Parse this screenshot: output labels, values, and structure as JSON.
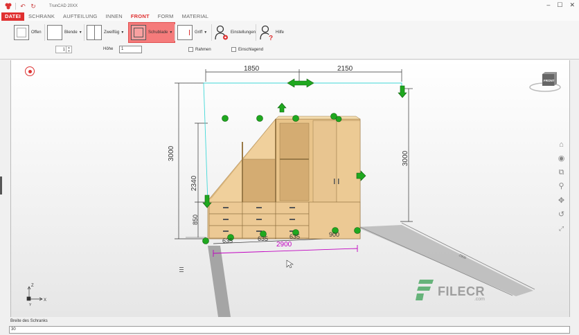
{
  "app": {
    "title": "TrunCAD 20XX"
  },
  "menu": {
    "items": [
      "DATEI",
      "SCHRANK",
      "AUFTEILUNG",
      "INNEN",
      "FRONT",
      "FORM",
      "MATERIAL"
    ],
    "active": "FRONT"
  },
  "ribbon": {
    "offen": "Offen",
    "blende": "Blende",
    "zweifluegelig": "Zweiflüg",
    "schublade": "Schublade",
    "griff": "Griff",
    "einstellungen": "Einstellungen",
    "hilfe": "Hilfe",
    "count_value": "1",
    "hoehe_label": "Höhe",
    "hoehe_value": "1",
    "rahmen": "Rahmen",
    "einschlagend": "Einschlagend"
  },
  "viewcube": {
    "label": "FRONT"
  },
  "dimensions": {
    "top_left": "1850",
    "top_right": "2150",
    "left_total": "3000",
    "left_upper": "2340",
    "left_lower": "850",
    "right_height": "3000",
    "bottom_width": "2900",
    "drawer_widths": [
      "635",
      "635",
      "635",
      "900"
    ],
    "floor_right": "2900"
  },
  "watermark": {
    "brand": "FILECR",
    "domain": ".com"
  },
  "status": {
    "label": "Breite des Schranks",
    "input_value": "30"
  },
  "colors": {
    "accent": "#e03030",
    "highlight": "#f57b7b",
    "wood": "#e8c48e",
    "handle": "#1fa81f",
    "dimension": "#c000c0",
    "guide": "#40d8d8"
  }
}
